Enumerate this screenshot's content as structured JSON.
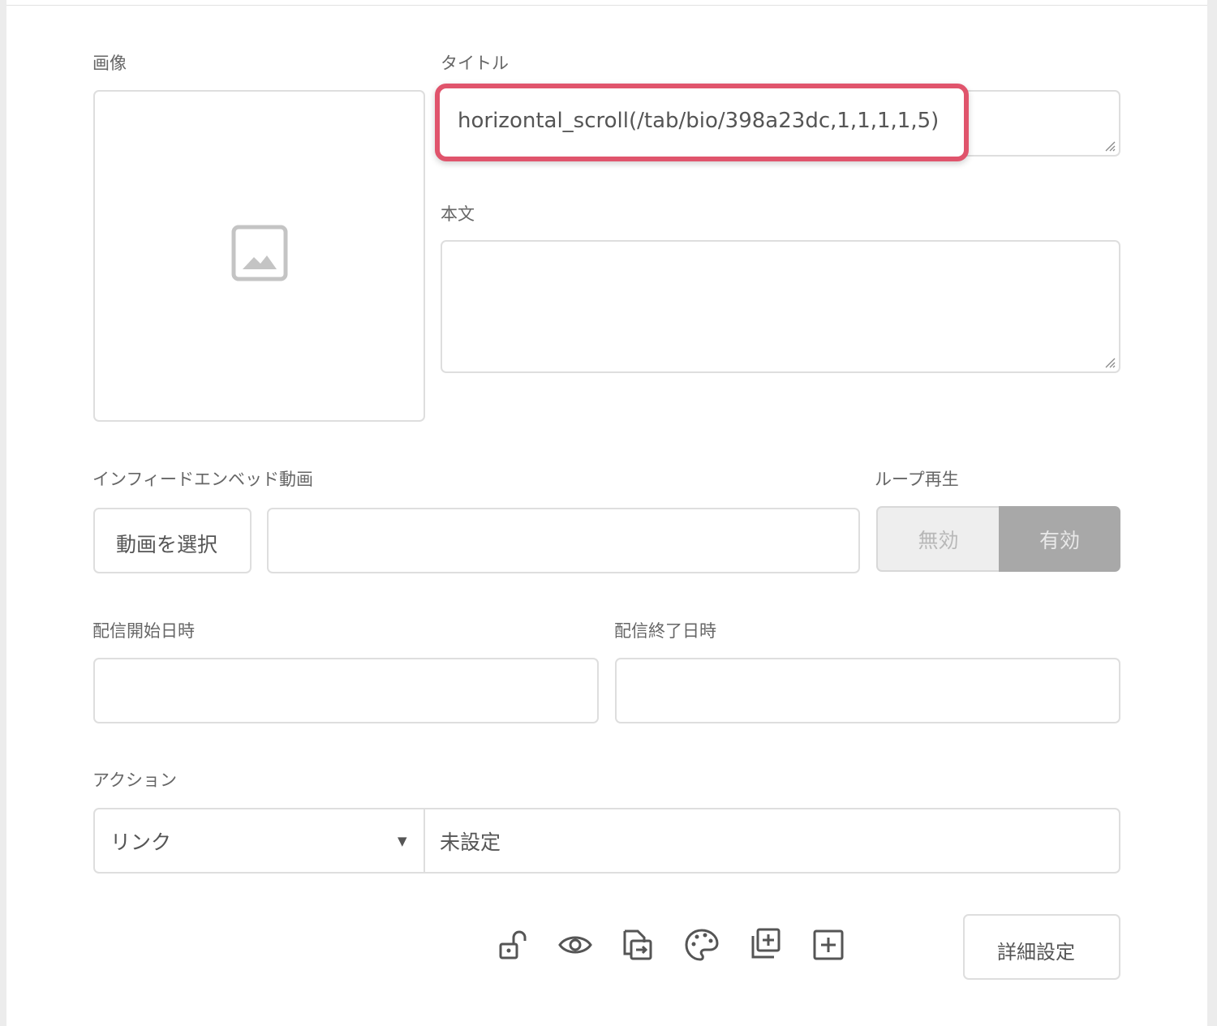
{
  "form": {
    "image_label": "画像",
    "title_label": "タイトル",
    "title_value": "horizontal_scroll(/tab/bio/398a23dc,1,1,1,1,5)",
    "body_label": "本文",
    "video_label": "インフィードエンベッド動画",
    "select_video_button": "動画を選択",
    "loop_label": "ループ再生",
    "loop_off": "無効",
    "loop_on": "有効",
    "start_label": "配信開始日時",
    "end_label": "配信終了日時",
    "action_label": "アクション",
    "action_type": "リンク",
    "action_value": "未設定",
    "details_button": "詳細設定"
  },
  "toolbar": {
    "icons": [
      "unlock-icon",
      "eye-icon",
      "export-icon",
      "palette-icon",
      "duplicate-icon",
      "add-icon"
    ]
  },
  "colors": {
    "highlight": "#e0546c",
    "toggle_active": "#a8a8a8",
    "border": "#dedede"
  }
}
